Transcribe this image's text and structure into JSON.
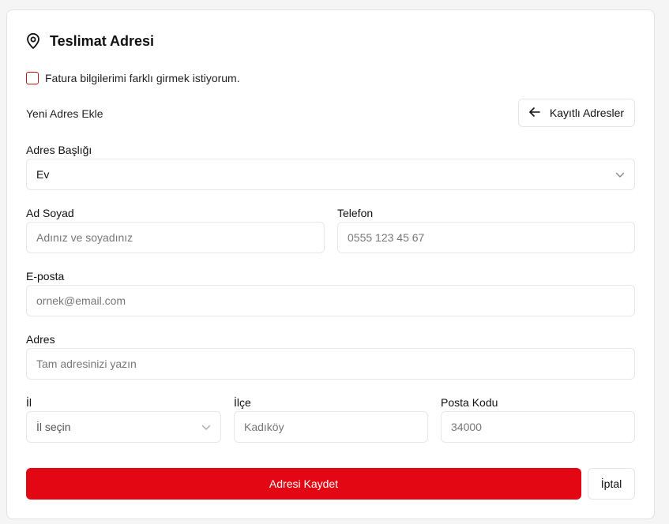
{
  "section": {
    "title": "Teslimat Adresi",
    "icon": "map-pin-icon"
  },
  "billing_checkbox": {
    "label": "Fatura bilgilerimi farklı girmek istiyorum.",
    "checked": false,
    "border_color": "#c4161c"
  },
  "new_address": {
    "label": "Yeni Adres Ekle"
  },
  "saved_addresses_button": {
    "label": "Kayıtlı Adresler",
    "icon": "arrow-left-icon"
  },
  "form": {
    "address_title": {
      "label": "Adres Başlığı",
      "value": "Ev"
    },
    "full_name": {
      "label": "Ad Soyad",
      "placeholder": "Adınız ve soyadınız"
    },
    "phone": {
      "label": "Telefon",
      "placeholder": "0555 123 45 67"
    },
    "email": {
      "label": "E-posta",
      "placeholder": "ornek@email.com"
    },
    "address": {
      "label": "Adres",
      "placeholder": "Tam adresinizi yazın"
    },
    "city": {
      "label": "İl",
      "placeholder": "İl seçin"
    },
    "district": {
      "label": "İlçe",
      "placeholder": "Kadıköy"
    },
    "postal_code": {
      "label": "Posta Kodu",
      "placeholder": "34000"
    }
  },
  "actions": {
    "save_label": "Adresi Kaydet",
    "cancel_label": "İptal",
    "accent_color": "#e30613"
  }
}
